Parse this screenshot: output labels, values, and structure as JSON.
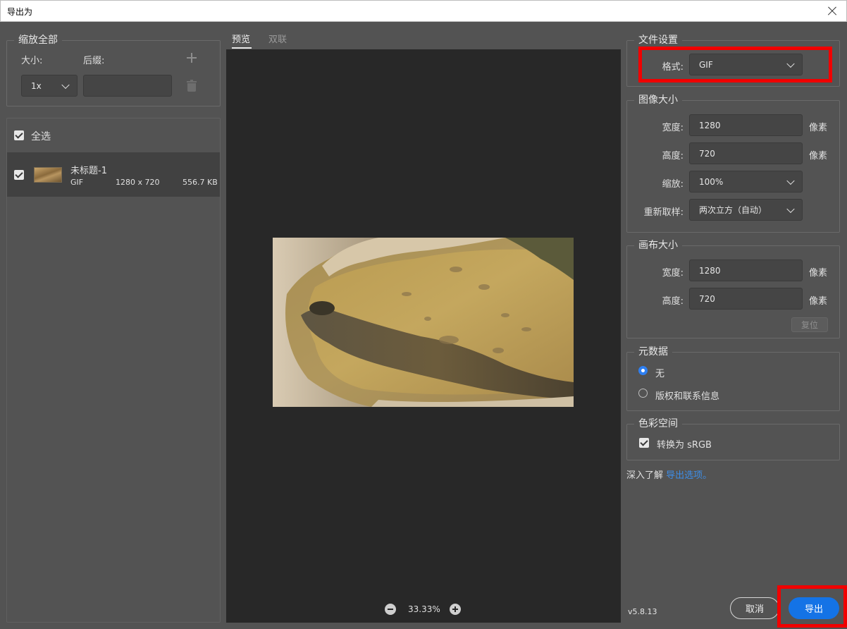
{
  "window": {
    "title": "导出为"
  },
  "left": {
    "scale_all": {
      "title": "缩放全部",
      "size_label": "大小:",
      "suffix_label": "后缀:",
      "size_value": "1x",
      "suffix_value": ""
    },
    "select_all_label": "全选",
    "file": {
      "name": "未标题-1",
      "format": "GIF",
      "dimensions": "1280 x 720",
      "filesize": "556.7 KB"
    }
  },
  "center": {
    "tabs": [
      {
        "label": "预览",
        "active": true
      },
      {
        "label": "双联",
        "active": false
      }
    ],
    "zoom": "33.33%"
  },
  "right": {
    "file_settings": {
      "title": "文件设置",
      "format_label": "格式:",
      "format_value": "GIF"
    },
    "image_size": {
      "title": "图像大小",
      "width_label": "宽度:",
      "width_value": "1280",
      "height_label": "高度:",
      "height_value": "720",
      "scale_label": "缩放:",
      "scale_value": "100%",
      "resample_label": "重新取样:",
      "resample_value": "两次立方（自动）",
      "unit": "像素"
    },
    "canvas_size": {
      "title": "画布大小",
      "width_label": "宽度:",
      "width_value": "1280",
      "height_label": "高度:",
      "height_value": "720",
      "unit": "像素",
      "reset_label": "复位"
    },
    "metadata": {
      "title": "元数据",
      "options": [
        {
          "label": "无",
          "selected": true
        },
        {
          "label": "版权和联系信息",
          "selected": false
        }
      ]
    },
    "color_space": {
      "title": "色彩空间",
      "convert_label": "转换为 sRGB",
      "checked": true
    },
    "learn_more": {
      "prefix": "深入了解",
      "link": "导出选项。"
    }
  },
  "footer": {
    "version": "v5.8.13",
    "cancel_label": "取消",
    "export_label": "导出"
  },
  "colors": {
    "panel_bg": "#535353",
    "preview_bg": "#282828",
    "accent": "#1473e6",
    "highlight": "#f00000"
  }
}
